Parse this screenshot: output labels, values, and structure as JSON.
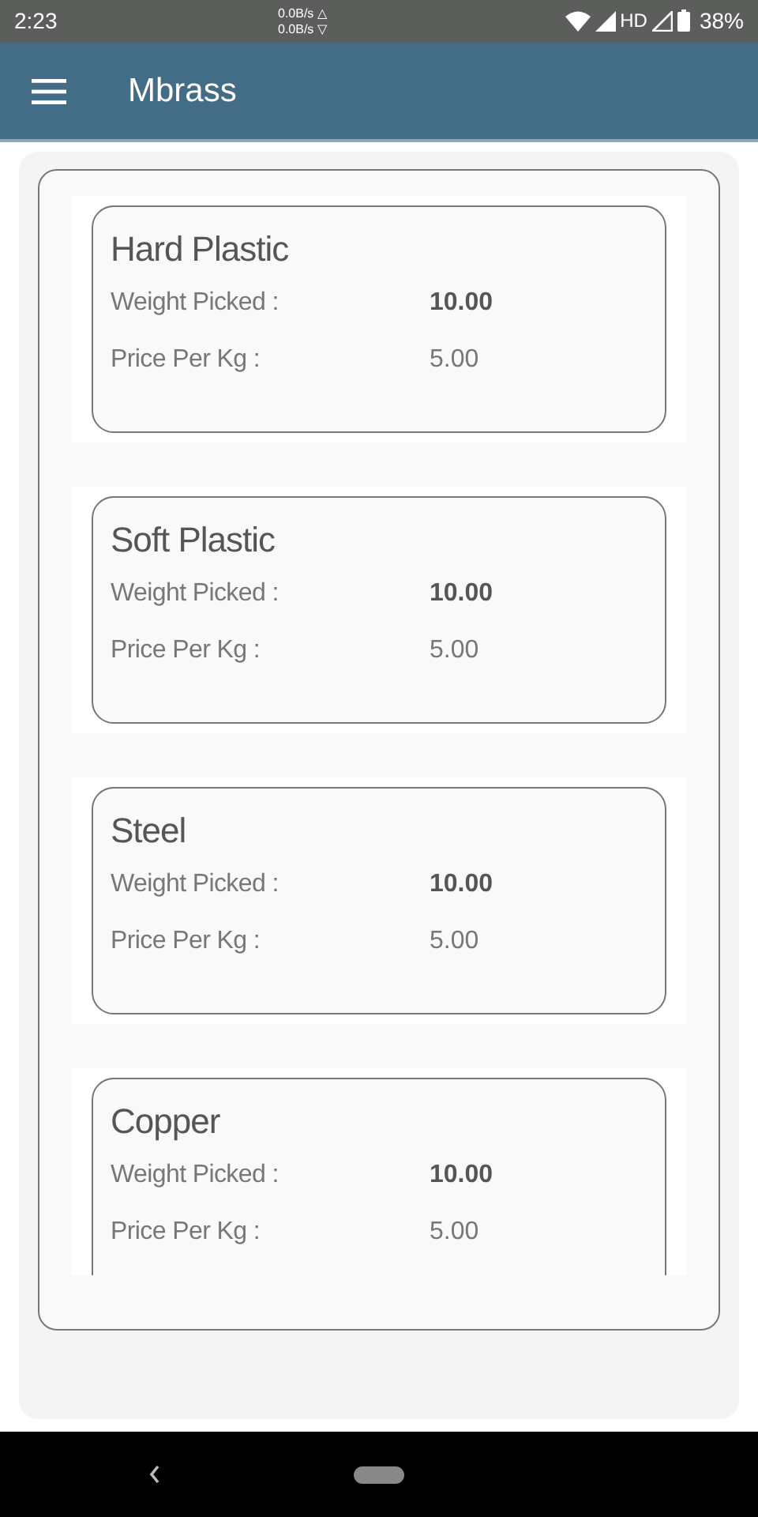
{
  "status_bar": {
    "time": "2:23",
    "speed_up": "0.0B/s △",
    "speed_down": "0.0B/s ▽",
    "network": "HD",
    "battery": "38%"
  },
  "app_bar": {
    "title": "Mbrass"
  },
  "materials": [
    {
      "name": "Hard Plastic",
      "weight_label": "Weight Picked :",
      "weight": "10.00",
      "price_label": "Price Per Kg :",
      "price": "5.00"
    },
    {
      "name": "Soft Plastic",
      "weight_label": "Weight Picked :",
      "weight": "10.00",
      "price_label": "Price Per Kg :",
      "price": "5.00"
    },
    {
      "name": "Steel",
      "weight_label": "Weight Picked :",
      "weight": "10.00",
      "price_label": "Price Per Kg :",
      "price": "5.00"
    },
    {
      "name": "Copper",
      "weight_label": "Weight Picked :",
      "weight": "10.00",
      "price_label": "Price Per Kg :",
      "price": "5.00"
    }
  ]
}
